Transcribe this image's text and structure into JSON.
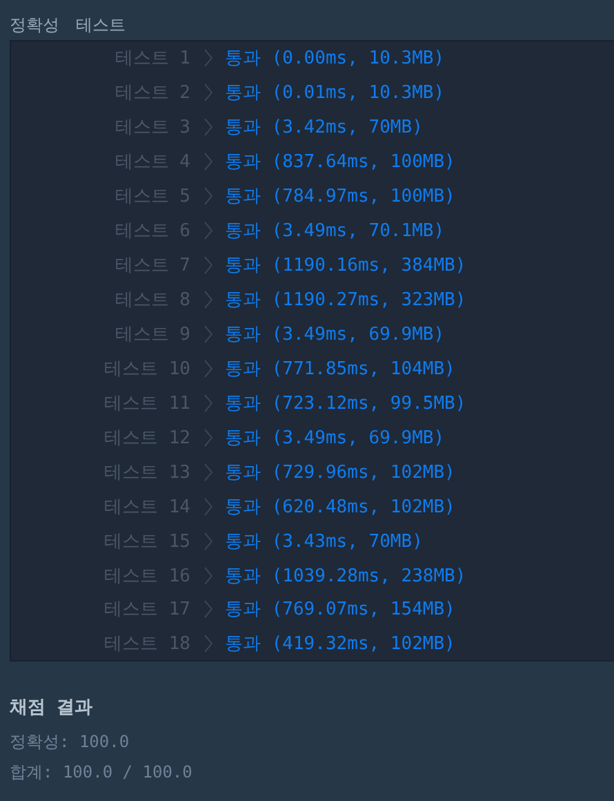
{
  "header": {
    "category": "정확성",
    "title": "테스트"
  },
  "tests": [
    {
      "label": "테스트 1",
      "result": "통과 (0.00ms, 10.3MB)"
    },
    {
      "label": "테스트 2",
      "result": "통과 (0.01ms, 10.3MB)"
    },
    {
      "label": "테스트 3",
      "result": "통과 (3.42ms, 70MB)"
    },
    {
      "label": "테스트 4",
      "result": "통과 (837.64ms, 100MB)"
    },
    {
      "label": "테스트 5",
      "result": "통과 (784.97ms, 100MB)"
    },
    {
      "label": "테스트 6",
      "result": "통과 (3.49ms, 70.1MB)"
    },
    {
      "label": "테스트 7",
      "result": "통과 (1190.16ms, 384MB)"
    },
    {
      "label": "테스트 8",
      "result": "통과 (1190.27ms, 323MB)"
    },
    {
      "label": "테스트 9",
      "result": "통과 (3.49ms, 69.9MB)"
    },
    {
      "label": "테스트 10",
      "result": "통과 (771.85ms, 104MB)"
    },
    {
      "label": "테스트 11",
      "result": "통과 (723.12ms, 99.5MB)"
    },
    {
      "label": "테스트 12",
      "result": "통과 (3.49ms, 69.9MB)"
    },
    {
      "label": "테스트 13",
      "result": "통과 (729.96ms, 102MB)"
    },
    {
      "label": "테스트 14",
      "result": "통과 (620.48ms, 102MB)"
    },
    {
      "label": "테스트 15",
      "result": "통과 (3.43ms, 70MB)"
    },
    {
      "label": "테스트 16",
      "result": "통과 (1039.28ms, 238MB)"
    },
    {
      "label": "테스트 17",
      "result": "통과 (769.07ms, 154MB)"
    },
    {
      "label": "테스트 18",
      "result": "통과 (419.32ms, 102MB)"
    }
  ],
  "summary": {
    "title": "채점 결과",
    "lines": [
      "정확성: 100.0",
      "합계: 100.0 / 100.0"
    ]
  }
}
